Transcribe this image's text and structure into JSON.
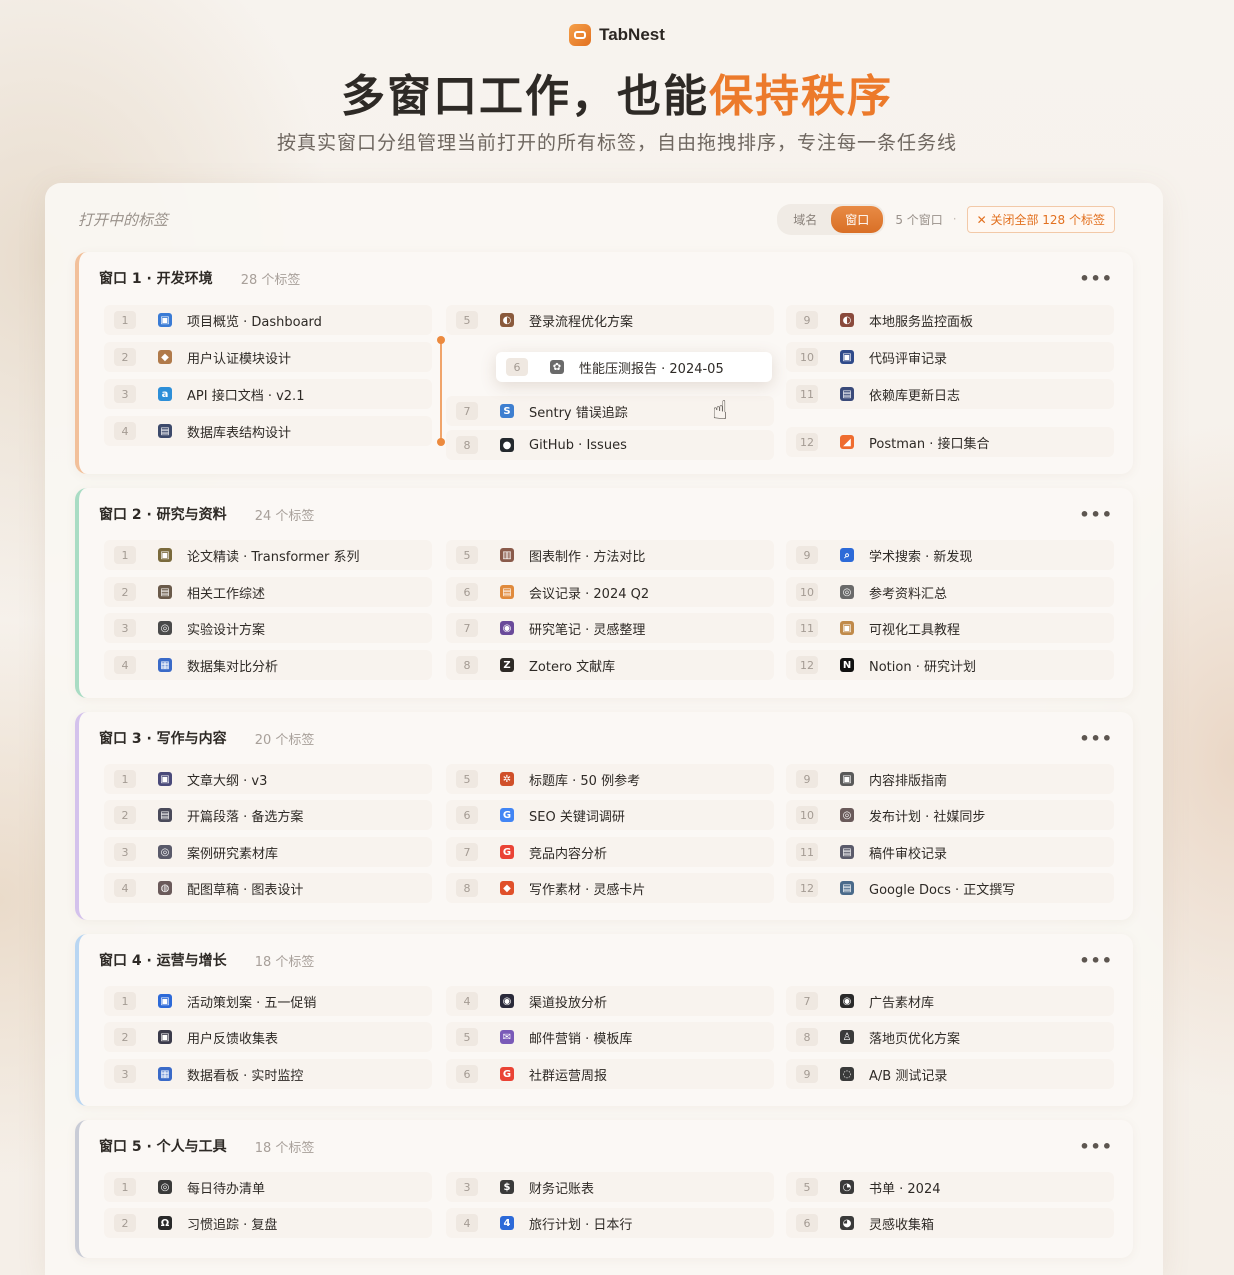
{
  "brand": {
    "name": "TabNest",
    "icon": "app-logo-icon",
    "accent": "#ec7a2b"
  },
  "hero": {
    "title_main": "多窗口工作，也能",
    "title_accent": "保持秩序",
    "subtitle": "按真实窗口分组管理当前打开的所有标签，自由拖拽排序，专注每一条任务线"
  },
  "panel": {
    "title": "打开中的标签",
    "seg_domain": "域名",
    "seg_window": "窗口",
    "window_count": "5 个窗口",
    "separator": "·",
    "close_all": "✕ 关闭全部 128 个标签"
  },
  "drag": {
    "num": "6",
    "icon": "gear-icon",
    "label": "性能压测报告 · 2024-05"
  },
  "windows": [
    {
      "title": "窗口 1 · 开发环境",
      "count": "28 个标签",
      "more": "•••",
      "accent": "#f2c09a",
      "tabs": [
        {
          "num": "1",
          "label": "项目概览 · Dashboard",
          "icon": "dashboard-icon",
          "color": "#3a7bd5",
          "glyph": "▣"
        },
        {
          "num": "2",
          "label": "用户认证模块设计",
          "icon": "user-shield-icon",
          "color": "#b07a4a",
          "glyph": "◆"
        },
        {
          "num": "3",
          "label": "API 接口文档 · v2.1",
          "icon": "api-doc-icon",
          "color": "#2d8fd8",
          "glyph": "a"
        },
        {
          "num": "4",
          "label": "数据库表结构设计",
          "icon": "database-icon",
          "color": "#3d4a6b",
          "glyph": "▤"
        },
        {
          "num": "5",
          "label": "登录流程优化方案",
          "icon": "login-flow-icon",
          "color": "#8a5a3c",
          "glyph": "◐"
        },
        {
          "num": "7",
          "label": "Sentry 错误追踪",
          "icon": "sentry-icon",
          "color": "#3e7fd0",
          "glyph": "S"
        },
        {
          "num": "8",
          "label": "GitHub · Issues",
          "icon": "github-icon",
          "color": "#24292e",
          "glyph": "●"
        },
        {
          "num": "9",
          "label": "本地服务监控面板",
          "icon": "monitor-icon",
          "color": "#8a4a3c",
          "glyph": "◐"
        },
        {
          "num": "10",
          "label": "代码评审记录",
          "icon": "code-review-icon",
          "color": "#2f4a8a",
          "glyph": "▣"
        },
        {
          "num": "11",
          "label": "依赖库更新日志",
          "icon": "changelog-icon",
          "color": "#3a4a7a",
          "glyph": "▤"
        },
        {
          "num": "12",
          "label": "Postman · 接口集合",
          "icon": "postman-icon",
          "color": "#ef6c2f",
          "glyph": "◢"
        }
      ]
    },
    {
      "title": "窗口 2 · 研究与资料",
      "count": "24 个标签",
      "more": "•••",
      "accent": "#a9dcc4",
      "tabs": [
        {
          "num": "1",
          "label": "论文精读 · Transformer 系列",
          "icon": "paper-icon",
          "color": "#7a6a3c",
          "glyph": "▣"
        },
        {
          "num": "2",
          "label": "相关工作综述",
          "icon": "survey-icon",
          "color": "#6a5a4a",
          "glyph": "▤"
        },
        {
          "num": "3",
          "label": "实验设计方案",
          "icon": "experiment-icon",
          "color": "#4a4a4a",
          "glyph": "◎"
        },
        {
          "num": "4",
          "label": "数据集对比分析",
          "icon": "dataset-icon",
          "color": "#3a6ac8",
          "glyph": "▦"
        },
        {
          "num": "5",
          "label": "图表制作 · 方法对比",
          "icon": "chart-icon",
          "color": "#8a5a4a",
          "glyph": "▥"
        },
        {
          "num": "6",
          "label": "会议记录 · 2024 Q2",
          "icon": "meeting-notes-icon",
          "color": "#e08a3c",
          "glyph": "▤"
        },
        {
          "num": "7",
          "label": "研究笔记 · 灵感整理",
          "icon": "notes-icon",
          "color": "#6a4a9a",
          "glyph": "◉"
        },
        {
          "num": "8",
          "label": "Zotero 文献库",
          "icon": "zotero-icon",
          "color": "#2e2a26",
          "glyph": "Z"
        },
        {
          "num": "9",
          "label": "学术搜索 · 新发现",
          "icon": "search-icon",
          "color": "#2d6ad8",
          "glyph": "⌕"
        },
        {
          "num": "10",
          "label": "参考资料汇总",
          "icon": "reference-icon",
          "color": "#6a6a6a",
          "glyph": "◎"
        },
        {
          "num": "11",
          "label": "可视化工具教程",
          "icon": "tutorial-icon",
          "color": "#c08a4a",
          "glyph": "▣"
        },
        {
          "num": "12",
          "label": "Notion · 研究计划",
          "icon": "notion-icon",
          "color": "#111111",
          "glyph": "N"
        }
      ]
    },
    {
      "title": "窗口 3 · 写作与内容",
      "count": "20 个标签",
      "more": "•••",
      "accent": "#d4c2ec",
      "tabs": [
        {
          "num": "1",
          "label": "文章大纲 · v3",
          "icon": "outline-icon",
          "color": "#4a4a7a",
          "glyph": "▣"
        },
        {
          "num": "2",
          "label": "开篇段落 · 备选方案",
          "icon": "paragraph-icon",
          "color": "#4a4a5a",
          "glyph": "▤"
        },
        {
          "num": "3",
          "label": "案例研究素材库",
          "icon": "case-study-icon",
          "color": "#5a5a6a",
          "glyph": "◎"
        },
        {
          "num": "4",
          "label": "配图草稿 · 图表设计",
          "icon": "image-draft-icon",
          "color": "#6a5a5a",
          "glyph": "◍"
        },
        {
          "num": "5",
          "label": "标题库 · 50 例参考",
          "icon": "headline-icon",
          "color": "#d0502a",
          "glyph": "✲"
        },
        {
          "num": "6",
          "label": "SEO 关键词调研",
          "icon": "google-icon",
          "color": "#4285f4",
          "glyph": "G"
        },
        {
          "num": "7",
          "label": "竞品内容分析",
          "icon": "google-icon",
          "color": "#ea4335",
          "glyph": "G"
        },
        {
          "num": "8",
          "label": "写作素材 · 灵感卡片",
          "icon": "inspiration-card-icon",
          "color": "#e0502a",
          "glyph": "◆"
        },
        {
          "num": "9",
          "label": "内容排版指南",
          "icon": "layout-guide-icon",
          "color": "#5a5a5a",
          "glyph": "▣"
        },
        {
          "num": "10",
          "label": "发布计划 · 社媒同步",
          "icon": "publish-icon",
          "color": "#6a5a5a",
          "glyph": "◎"
        },
        {
          "num": "11",
          "label": "稿件审校记录",
          "icon": "proofread-icon",
          "color": "#5a5a6a",
          "glyph": "▤"
        },
        {
          "num": "12",
          "label": "Google Docs · 正文撰写",
          "icon": "docs-icon",
          "color": "#4a6a8a",
          "glyph": "▤"
        }
      ]
    },
    {
      "title": "窗口 4 · 运营与增长",
      "count": "18 个标签",
      "more": "•••",
      "accent": "#b9d6f2",
      "tabs": [
        {
          "num": "1",
          "label": "活动策划案 · 五一促销",
          "icon": "campaign-icon",
          "color": "#2d6ad8",
          "glyph": "▣"
        },
        {
          "num": "2",
          "label": "用户反馈收集表",
          "icon": "feedback-icon",
          "color": "#3a3a4a",
          "glyph": "▣"
        },
        {
          "num": "3",
          "label": "数据看板 · 实时监控",
          "icon": "analytics-icon",
          "color": "#3a6ac8",
          "glyph": "▦"
        },
        {
          "num": "4",
          "label": "渠道投放分析",
          "icon": "channel-icon",
          "color": "#2a2a3a",
          "glyph": "◉"
        },
        {
          "num": "5",
          "label": "邮件营销 · 模板库",
          "icon": "email-icon",
          "color": "#7a5ab8",
          "glyph": "✉"
        },
        {
          "num": "6",
          "label": "社群运营周报",
          "icon": "google-icon",
          "color": "#ea4335",
          "glyph": "G"
        },
        {
          "num": "7",
          "label": "广告素材库",
          "icon": "ad-assets-icon",
          "color": "#2a2a2a",
          "glyph": "◉"
        },
        {
          "num": "8",
          "label": "落地页优化方案",
          "icon": "landing-page-icon",
          "color": "#3a3a3a",
          "glyph": "♙"
        },
        {
          "num": "9",
          "label": "A/B 测试记录",
          "icon": "ab-test-icon",
          "color": "#3a3a3a",
          "glyph": "◌"
        }
      ]
    },
    {
      "title": "窗口 5 · 个人与工具",
      "count": "18 个标签",
      "more": "•••",
      "accent": "#c9ccd6",
      "tabs": [
        {
          "num": "1",
          "label": "每日待办清单",
          "icon": "todo-icon",
          "color": "#3a3a3a",
          "glyph": "◎"
        },
        {
          "num": "2",
          "label": "习惯追踪 · 复盘",
          "icon": "habit-icon",
          "color": "#2a2a2a",
          "glyph": "Ω"
        },
        {
          "num": "3",
          "label": "财务记账表",
          "icon": "finance-icon",
          "color": "#3a3a3a",
          "glyph": "$"
        },
        {
          "num": "4",
          "label": "旅行计划 · 日本行",
          "icon": "travel-icon",
          "color": "#2d6ad8",
          "glyph": "4"
        },
        {
          "num": "5",
          "label": "书单 · 2024",
          "icon": "book-list-icon",
          "color": "#3a3a3a",
          "glyph": "◔"
        },
        {
          "num": "6",
          "label": "灵感收集箱",
          "icon": "idea-box-icon",
          "color": "#3a3a3a",
          "glyph": "◕"
        }
      ]
    }
  ]
}
